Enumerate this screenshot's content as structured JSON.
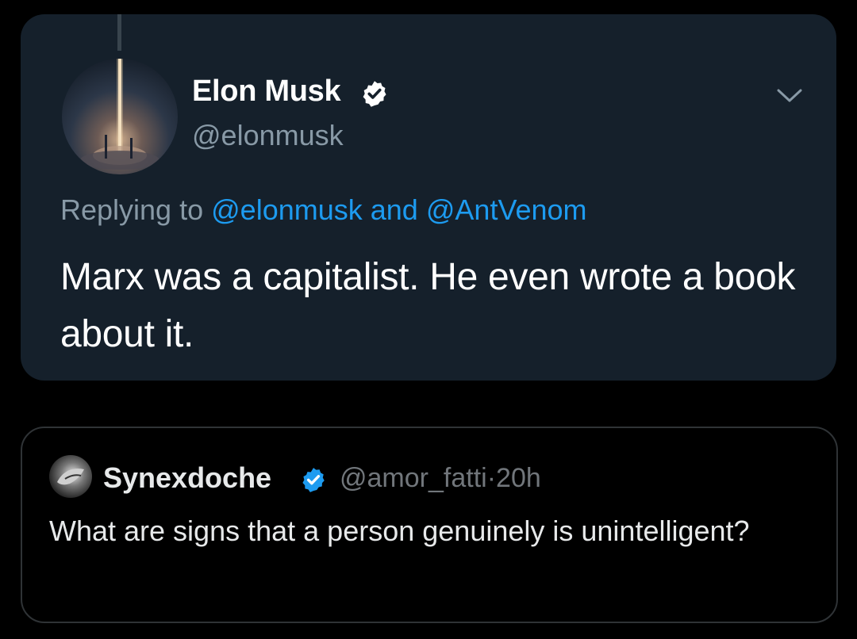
{
  "reply_tweet": {
    "author_name": "Elon Musk",
    "author_handle": "@elonmusk",
    "replying_prefix": "Replying to",
    "replying_mention_1": "@elonmusk",
    "replying_and": "and",
    "replying_mention_2": "@AntVenom",
    "text": "Marx was a capitalist. He even wrote a book about it.",
    "avatar_icon": "rocket-launch-avatar",
    "verified_icon": "verified-badge-icon",
    "menu_icon": "chevron-down-icon"
  },
  "quoted_tweet": {
    "author_name": "Synexdoche",
    "author_handle": "@amor_fatti",
    "separator": "·",
    "time_ago": "20h",
    "text": "What are signs that a person genuinely is unintelligent?",
    "verified_icon": "verified-badge-icon"
  },
  "colors": {
    "card_background": "#15202b",
    "mention_blue": "#1d9bf0",
    "secondary_text": "#8899a6",
    "verified_blue": "#1d9bf0"
  }
}
